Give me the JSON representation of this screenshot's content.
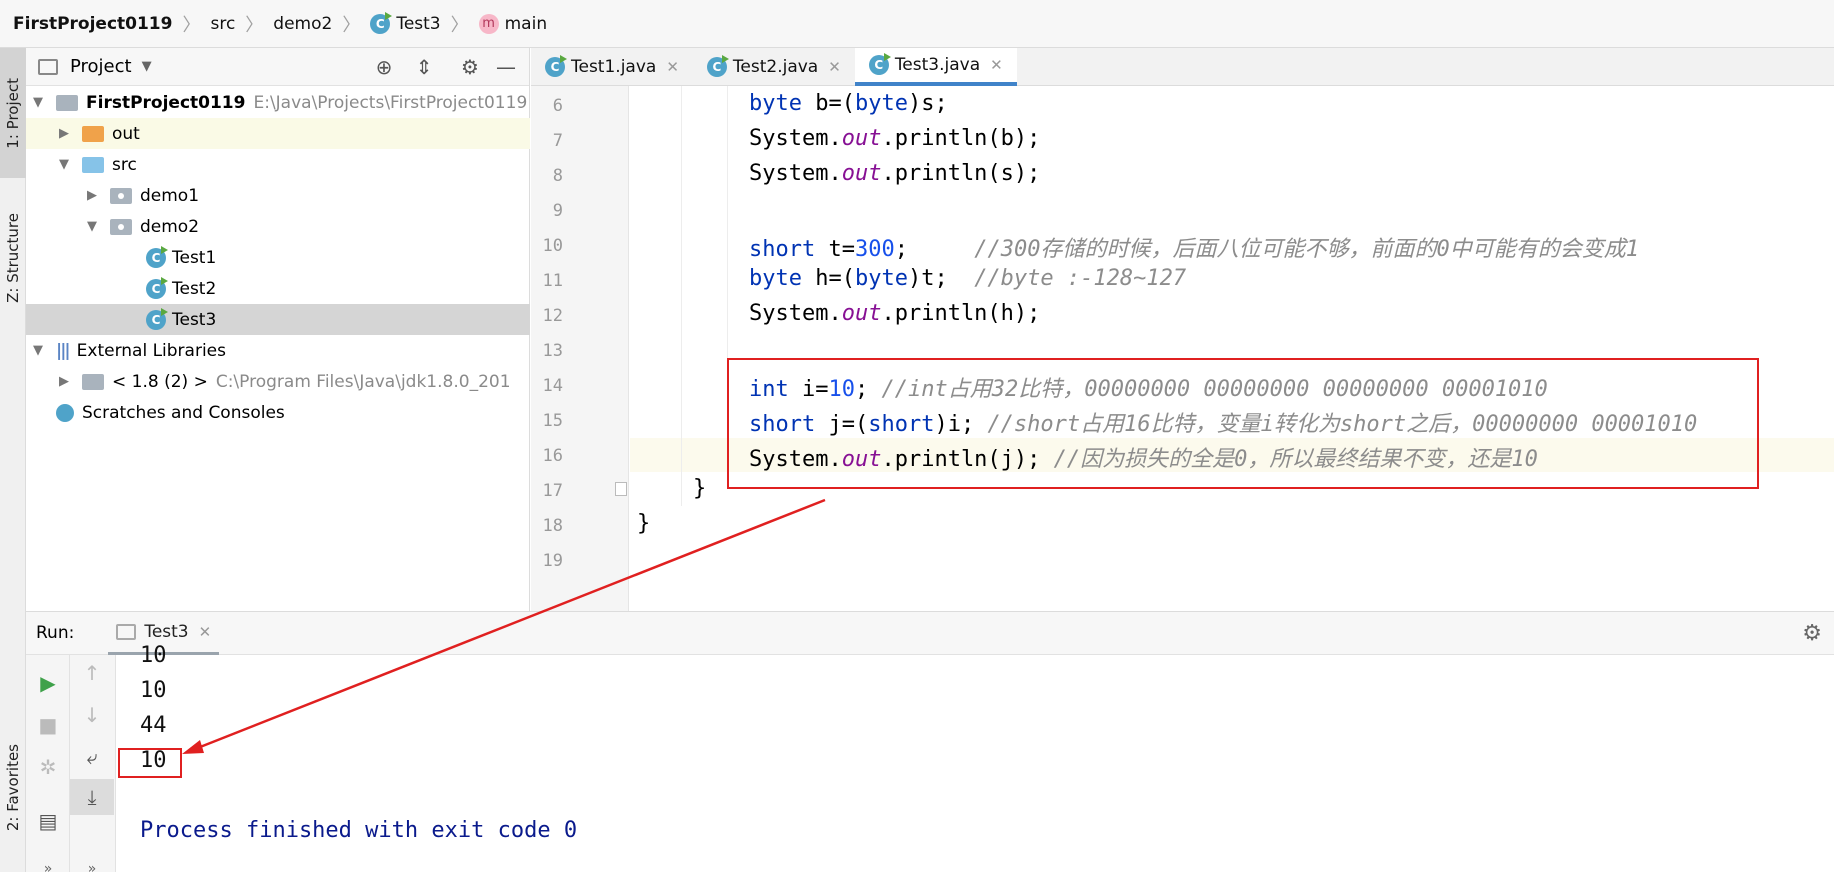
{
  "breadcrumb": {
    "project": "FirstProject0119",
    "src": "src",
    "package": "demo2",
    "class": "Test3",
    "class_icon": "C",
    "method": "main",
    "method_icon": "m"
  },
  "left_strip": {
    "project_tab": "1: Project",
    "structure_tab": "Z: Structure",
    "favorites_tab": "2: Favorites"
  },
  "project_panel": {
    "title": "Project",
    "tree": {
      "root_name": "FirstProject0119",
      "root_path": "E:\\Java\\Projects\\FirstProject0119",
      "out": "out",
      "src": "src",
      "demo1": "demo1",
      "demo2": "demo2",
      "test1": "Test1",
      "test2": "Test2",
      "test3": "Test3",
      "external_libraries": "External Libraries",
      "jdk": "< 1.8 (2) >",
      "jdk_path": "C:\\Program Files\\Java\\jdk1.8.0_201",
      "scratches": "Scratches and Consoles"
    }
  },
  "editor": {
    "tabs": [
      "Test1.java",
      "Test2.java",
      "Test3.java"
    ],
    "active_tab": "Test3.java",
    "line_numbers": [
      "6",
      "7",
      "8",
      "9",
      "10",
      "11",
      "12",
      "13",
      "14",
      "15",
      "16",
      "17",
      "18",
      "19"
    ],
    "code": {
      "l6": {
        "t1": "byte",
        "t2": " b=(",
        "t3": "byte",
        "t4": ")s;"
      },
      "l7": {
        "t1": "System.",
        "t2": "out",
        "t3": ".println(b);"
      },
      "l8": {
        "t1": "System.",
        "t2": "out",
        "t3": ".println(s);"
      },
      "l10": {
        "t1": "short",
        "t2": " t=",
        "t3": "300",
        "t4": ";     ",
        "t5": "//300存储的时候，后面八位可能不够，前面的0中可能有的会变成1"
      },
      "l11": {
        "t1": "byte",
        "t2": " h=(",
        "t3": "byte",
        "t4": ")t;  ",
        "t5": "//byte :-128~127"
      },
      "l12": {
        "t1": "System.",
        "t2": "out",
        "t3": ".println(h);"
      },
      "l14": {
        "t1": "int",
        "t2": " i=",
        "t3": "10",
        "t4": "; ",
        "t5": "//int占用32比特，00000000 00000000 00000000 00001010"
      },
      "l15": {
        "t1": "short",
        "t2": " j=(",
        "t3": "short",
        "t4": ")i; ",
        "t5": "//short占用16比特，变量i转化为short之后，00000000 00001010"
      },
      "l16": {
        "t1": "System.",
        "t2": "out",
        "t3": ".println(j); ",
        "t4": "//因为损失的全是0，所以最终结果不变，还是10"
      },
      "l17": "}",
      "l18": "}"
    }
  },
  "run_panel": {
    "label": "Run:",
    "tab": "Test3",
    "output": [
      "10",
      "10",
      "44",
      "10"
    ],
    "process": "Process finished with exit code 0"
  },
  "colors": {
    "keyword": "#0033b3",
    "number": "#1750eb",
    "field": "#871094",
    "comment": "#8c8c8c",
    "annotation": "#e02020",
    "active_tab_underline": "#4083c9"
  }
}
